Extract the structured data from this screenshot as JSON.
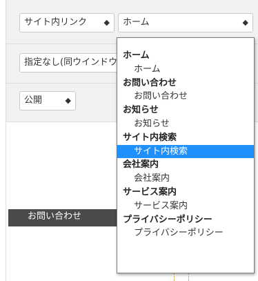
{
  "link_type": {
    "value": "サイト内リンク",
    "arrow": "◆"
  },
  "page_select": {
    "value": "ホーム",
    "arrow": "◆"
  },
  "target_select": {
    "value": "指定なし(同ウインドウ)",
    "arrow": "◆"
  },
  "status_select": {
    "value": "公開",
    "arrow": "◆"
  },
  "preview": {
    "label": "お問い合わせ"
  },
  "dropdown": {
    "groups": [
      {
        "label": "ホーム",
        "options": [
          "ホーム"
        ]
      },
      {
        "label": "お問い合わせ",
        "options": [
          "お問い合わせ"
        ]
      },
      {
        "label": "お知らせ",
        "options": [
          "お知らせ"
        ]
      },
      {
        "label": "サイト内検索",
        "options": [
          "サイト内検索"
        ]
      },
      {
        "label": "会社案内",
        "options": [
          "会社案内"
        ]
      },
      {
        "label": "サービス案内",
        "options": [
          "サービス案内"
        ]
      },
      {
        "label": "プライバシーポリシー",
        "options": [
          "プライバシーポリシー"
        ]
      }
    ],
    "selected": "サイト内検索"
  },
  "colors": {
    "highlight": "#1e90ff",
    "row_bg": "#f1f1f1",
    "preview_bar": "#4a4a4a"
  }
}
